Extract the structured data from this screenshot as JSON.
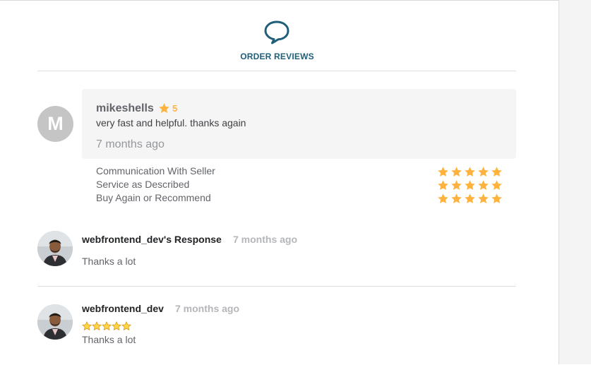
{
  "header": {
    "title": "ORDER REVIEWS",
    "icon": "chat-bubble-icon"
  },
  "review": {
    "avatar_letter": "M",
    "reviewer": "mikeshells",
    "rating": "5",
    "text": "very fast and helpful. thanks again",
    "time": "7 months ago",
    "breakdown": [
      {
        "label": "Communication With Seller",
        "stars": 5
      },
      {
        "label": "Service as Described",
        "stars": 5
      },
      {
        "label": "Buy Again or Recommend",
        "stars": 5
      }
    ]
  },
  "seller_response": {
    "name": "webfrontend_dev's Response",
    "time": "7 months ago",
    "text": "Thanks a lot"
  },
  "seller_review": {
    "name": "webfrontend_dev",
    "time": "7 months ago",
    "stars": 5,
    "text": "Thanks a lot"
  },
  "colors": {
    "star": "#ffb33e",
    "header_accent": "#1f5f7a",
    "review_bg": "#f5f5f5"
  }
}
